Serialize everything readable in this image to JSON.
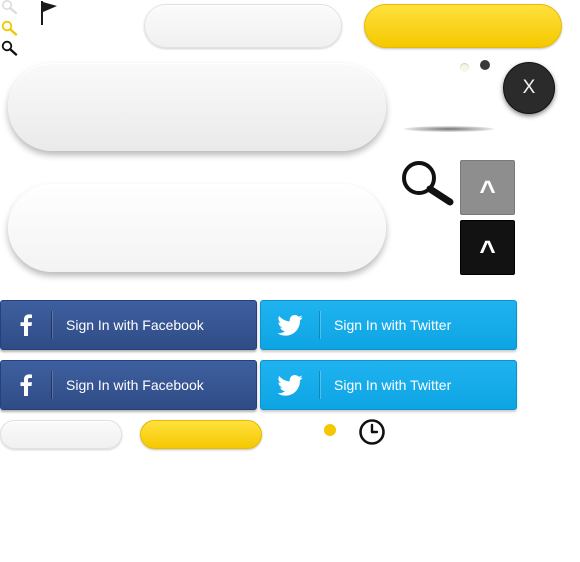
{
  "colors": {
    "accent_yellow": "#f7cb00",
    "facebook_blue": "#34528f",
    "twitter_blue": "#12a9e8",
    "close_dark": "#2b2b2b",
    "scroll_gray": "#8e8e8e",
    "scroll_black": "#121212"
  },
  "close_button": {
    "label": "X"
  },
  "scroll_buttons": {
    "gray_label": "^",
    "black_label": "^"
  },
  "social": {
    "facebook_label": "Sign In with Facebook",
    "twitter_label": "Sign In with Twitter"
  },
  "icons": [
    "search-icon-light",
    "flag-icon",
    "search-icon-yellow",
    "search-icon-black",
    "search-icon-large",
    "clock-icon",
    "facebook-icon",
    "twitter-icon"
  ]
}
